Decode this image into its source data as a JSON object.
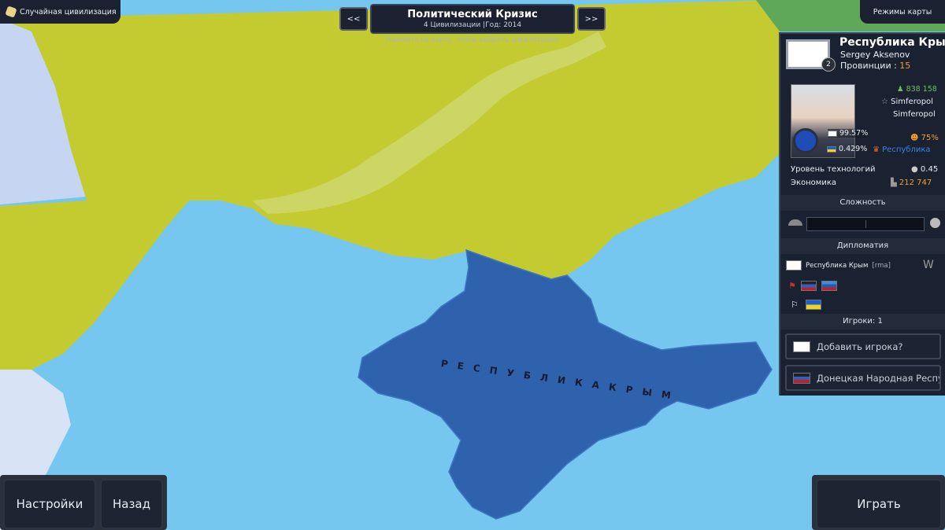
{
  "top_left": {
    "label": "Случайная цивилизация",
    "icon": "dice-icon"
  },
  "top_right": {
    "label": "Режимы карты"
  },
  "header": {
    "title": "Политический Кризис",
    "subtitle": "4 Цивилизации |Год: 2014",
    "prev_label": "<<",
    "next_label": ">>",
    "hint": "Нажмите на карту, чтобы выбрать цивилизацию"
  },
  "map": {
    "label": "Р Е С П У Б Л И К А   К Р Ы М",
    "colors": {
      "sea": "#76c7ef",
      "ukraine": "#c4cb30",
      "crimea": "#2f62ad",
      "river": "#d2d87a",
      "neighbor_east": "#c6d6f2"
    }
  },
  "civ": {
    "name": "Республика Крым",
    "leader": "Sergey Aksenov",
    "provinces_label": "Провинции :",
    "provinces": "15",
    "rank": "2",
    "population": "838 158",
    "capital": "Simferopol",
    "capital2": "Simferopol",
    "stability": "75%",
    "ideology_share": "99.57%",
    "other_share": "0.429%",
    "government": "Республика",
    "tech_label": "Уровень технологий",
    "tech_value": "0.45",
    "economy_label": "Экономика",
    "economy_value": "212 747"
  },
  "difficulty": {
    "title": "Сложность"
  },
  "diplomacy": {
    "title": "Дипломатия",
    "self_label": "Республика Крым",
    "self_tag": "[rma]"
  },
  "players": {
    "title": "Игроки: 1",
    "add_label": "Добавить игрока?",
    "second_label": "Донецкая Народная Республика"
  },
  "bottom": {
    "settings_label": "Настройки",
    "back_label": "Назад",
    "play_label": "Играть"
  }
}
